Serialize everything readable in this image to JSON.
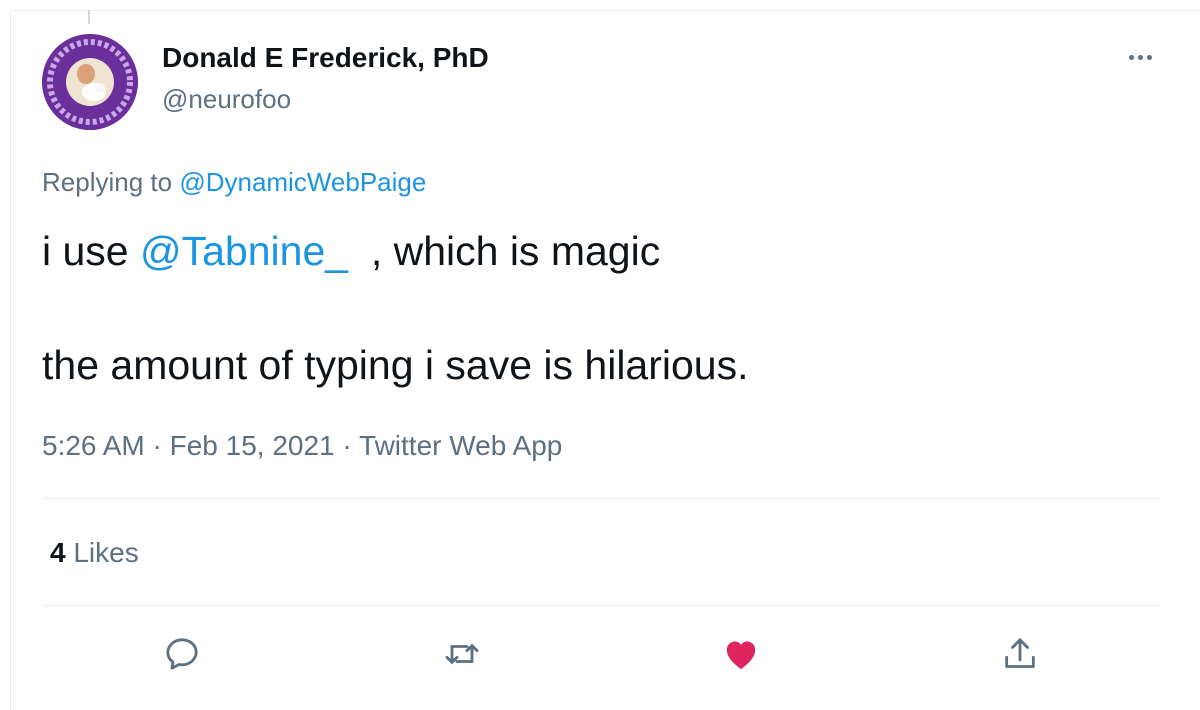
{
  "tweet": {
    "author_name": "Donald E Frederick, PhD",
    "author_handle": "@neurofoo",
    "replying_prefix": "Replying to ",
    "replying_to": "@DynamicWebPaige",
    "text_line1_pre": "i use ",
    "text_mention": "@Tabnine_",
    "text_line1_post": "  , which is magic",
    "text_line2": "the amount of typing i save is hilarious.",
    "timestamp": "5:26 AM · Feb 15, 2021 · Twitter Web App",
    "likes_count": "4",
    "likes_label": "Likes"
  },
  "actions": [
    {
      "name": "reply",
      "icon": "reply-icon"
    },
    {
      "name": "retweet",
      "icon": "retweet-icon"
    },
    {
      "name": "like",
      "icon": "heart-icon",
      "liked": true,
      "color": "#e0245e"
    },
    {
      "name": "share",
      "icon": "share-icon"
    }
  ],
  "colors": {
    "link": "#1b95e0",
    "secondary_text": "#5b7083",
    "primary_text": "#0f1419",
    "like": "#e0245e",
    "avatar_ring": "#7b3fa8"
  }
}
